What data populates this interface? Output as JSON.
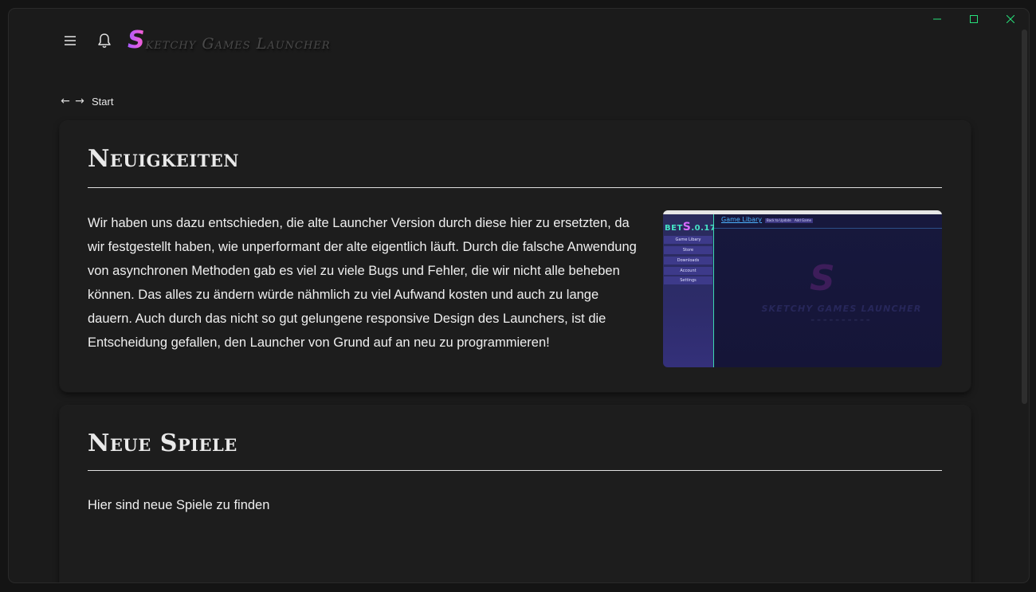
{
  "window": {
    "controls": {
      "minimize_icon": "minimize-icon",
      "maximize_icon": "maximize-icon",
      "close_icon": "close-icon"
    },
    "accent_color": "#27e07a"
  },
  "topbar": {
    "menu_icon": "hamburger-menu-icon",
    "bell_icon": "bell-icon",
    "brand_initial": "S",
    "brand_rest": "ketchy Games Launcher"
  },
  "nav": {
    "back_icon": "arrow-left-icon",
    "forward_icon": "arrow-right-icon",
    "breadcrumb": "Start"
  },
  "news": {
    "title": "Neuigkeiten",
    "text": "Wir haben uns dazu entschieden, die alte Launcher Version durch diese hier zu ersetzten, da wir festgestellt haben, wie unperformant der alte eigentlich läuft. Durch die falsche Anwendung von asynchronen Methoden gab es viel zu viele Bugs und Fehler, die wir nicht alle beheben können. Das alles zu ändern würde nähmlich zu viel Aufwand kosten und auch zu lange dauern. Auch durch das nicht so gut gelungene responsive Design des Launchers, ist die Entscheidung gefallen, den Launcher von Grund auf an neu zu programmieren!",
    "preview": {
      "logo_prefix": "BET",
      "logo_s": "S",
      "logo_suffix": ".0.17",
      "menu": [
        "Game Libary",
        "Store",
        "Downloads",
        "Account",
        "Settings"
      ],
      "header_link": "Game Libary",
      "buttons": [
        "Back to Update",
        "Add Game"
      ],
      "watermark_s": "S",
      "watermark_title": "SKETCHY GAMES LAUNCHER"
    }
  },
  "new_games": {
    "title": "Neue Spiele",
    "text": "Hier sind neue Spiele zu finden"
  }
}
